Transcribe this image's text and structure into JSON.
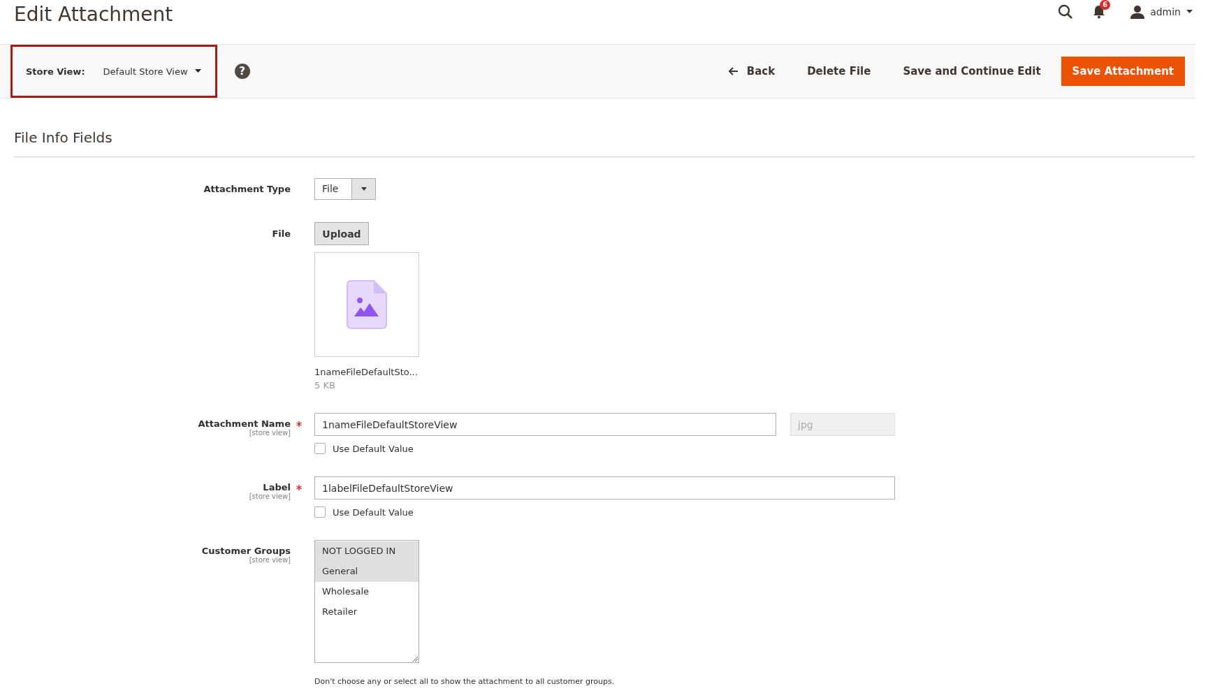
{
  "page_title": "Edit Attachment",
  "header": {
    "notification_count": "6",
    "user": "admin"
  },
  "store_view": {
    "label": "Store View:",
    "value": "Default Store View",
    "highlighted": true
  },
  "help_glyph": "?",
  "actions": [
    {
      "label": "Back",
      "kind": "back"
    },
    {
      "label": "Delete File",
      "kind": "plain"
    },
    {
      "label": "Save and Continue Edit",
      "kind": "plain"
    },
    {
      "label": "Save Attachment",
      "kind": "primary"
    }
  ],
  "section_title": "File Info Fields",
  "form": {
    "attachment_type": {
      "label": "Attachment Type",
      "value": "File"
    },
    "file": {
      "label": "File",
      "button": "Upload",
      "file_name": "1nameFileDefaultSto...",
      "file_size": "5 KB"
    },
    "attachment_name": {
      "label": "Attachment Name",
      "required": true,
      "scope": "[store view]",
      "value": "1nameFileDefaultStoreView",
      "extension": "jpg",
      "use_default": {
        "label": "Use Default Value",
        "checked": false
      }
    },
    "label": {
      "label": "Label",
      "required": true,
      "scope": "[store view]",
      "value": "1labelFileDefaultStoreView",
      "use_default": {
        "label": "Use Default Value",
        "checked": false
      }
    },
    "customer_groups": {
      "label": "Customer Groups",
      "scope": "[store view]",
      "options": [
        {
          "label": "NOT LOGGED IN",
          "selected": true
        },
        {
          "label": "General",
          "selected": true
        },
        {
          "label": "Wholesale",
          "selected": false
        },
        {
          "label": "Retailer",
          "selected": false
        }
      ],
      "note": "Don't choose any or select all to show the attachment to all customer groups."
    }
  }
}
